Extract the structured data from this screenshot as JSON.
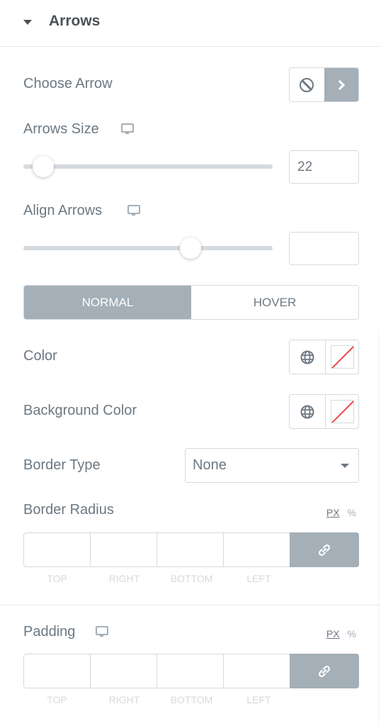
{
  "section": {
    "title": "Arrows",
    "expanded": true
  },
  "choose_arrow": {
    "label": "Choose Arrow",
    "options": [
      "none",
      "chevron-right"
    ],
    "selected": "chevron-right"
  },
  "arrows_size": {
    "label": "Arrows Size",
    "value": "22",
    "slider_fraction": 0.08
  },
  "align_arrows": {
    "label": "Align Arrows",
    "value": "",
    "slider_fraction": 0.67
  },
  "state_tabs": [
    {
      "label": "NORMAL",
      "active": true
    },
    {
      "label": "HOVER",
      "active": false
    }
  ],
  "color": {
    "label": "Color",
    "value": "none"
  },
  "background_color": {
    "label": "Background Color",
    "value": "none"
  },
  "border_type": {
    "label": "Border Type",
    "value": "None"
  },
  "border_radius": {
    "label": "Border Radius",
    "units": [
      "PX",
      "%"
    ],
    "selected_unit": "PX",
    "fields": [
      {
        "label": "TOP",
        "value": ""
      },
      {
        "label": "RIGHT",
        "value": ""
      },
      {
        "label": "BOTTOM",
        "value": ""
      },
      {
        "label": "LEFT",
        "value": ""
      }
    ],
    "linked": true
  },
  "padding": {
    "label": "Padding",
    "units": [
      "PX",
      "%"
    ],
    "selected_unit": "PX",
    "fields": [
      {
        "label": "TOP",
        "value": ""
      },
      {
        "label": "RIGHT",
        "value": ""
      },
      {
        "label": "BOTTOM",
        "value": ""
      },
      {
        "label": "LEFT",
        "value": ""
      }
    ],
    "linked": true
  },
  "colors": {
    "accent_gray": "#a4afb7",
    "text": "#6d7882",
    "border": "#d5dadf",
    "none_swatch_line": "#f0454a"
  }
}
